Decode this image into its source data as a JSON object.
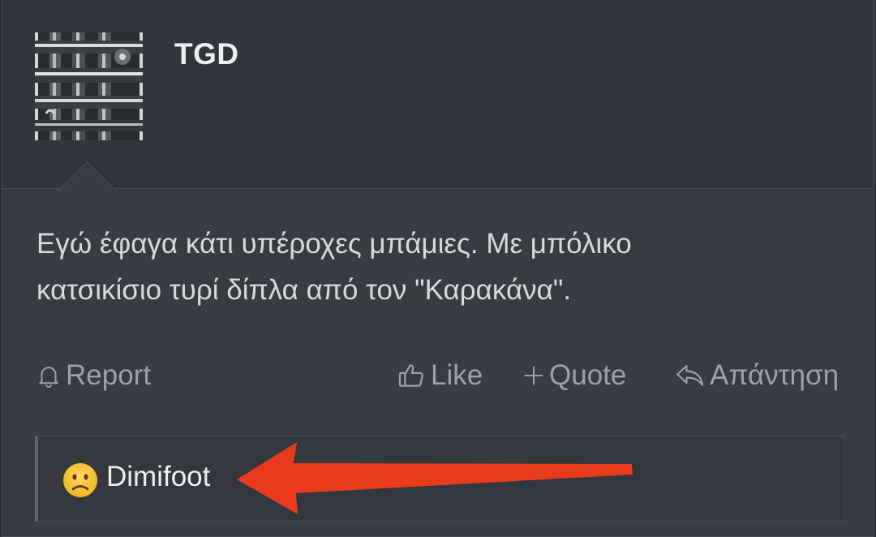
{
  "post": {
    "author": "TGD",
    "avatar_icon": "trumpet-valves-photo",
    "body_line1": "Εγώ έφαγα κάτι υπέροχες μπάμιες. Με μπόλικο",
    "body_line2": "κατσικίσιο τυρί δίπλα από τον \"Καρακάνα\"."
  },
  "actions": {
    "report_label": "Report",
    "like_label": "Like",
    "quote_label": "Quote",
    "reply_label": "Απάντηση"
  },
  "reactions": {
    "emoji_icon": "confused-face-icon",
    "user": "Dimifoot"
  },
  "colors": {
    "annotation_arrow": "#ea3a1e"
  }
}
